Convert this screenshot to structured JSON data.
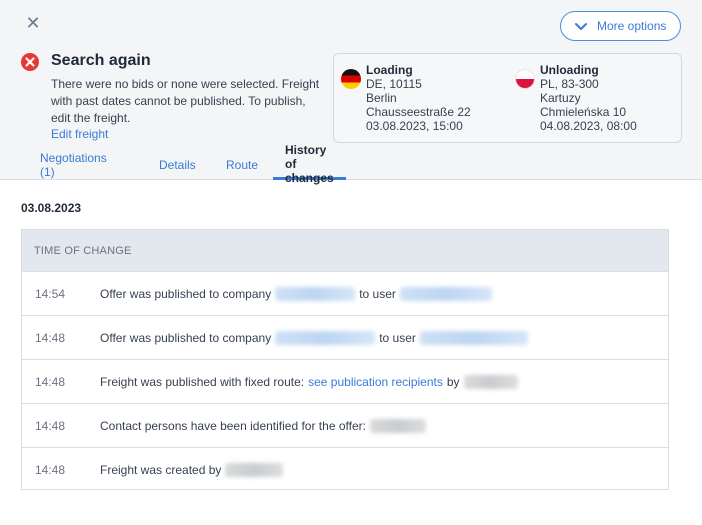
{
  "header": {
    "more_options_label": "More options",
    "status": {
      "title": "Search again",
      "text": "There were no bids or none were selected. Freight with past dates cannot be published. To publish, edit the freight.",
      "edit_link": "Edit freight"
    },
    "loading": {
      "label": "Loading",
      "country_zip": "DE, 10115",
      "city": "Berlin",
      "street": "Chausseestraße 22",
      "datetime": "03.08.2023, 15:00"
    },
    "unloading": {
      "label": "Unloading",
      "country_zip": "PL, 83-300",
      "city": "Kartuzy",
      "street": "Chmieleńska 10",
      "datetime": "04.08.2023, 08:00"
    },
    "tabs": [
      {
        "label": "Negotiations (1)"
      },
      {
        "label": "Details"
      },
      {
        "label": "Route"
      },
      {
        "label": "History of changes"
      }
    ]
  },
  "history": {
    "date": "03.08.2023",
    "column_header": "TIME OF CHANGE",
    "rows": [
      {
        "time": "14:54",
        "text_a": "Offer was published to company",
        "text_b": "to user"
      },
      {
        "time": "14:48",
        "text_a": "Offer was published to company",
        "text_b": "to user"
      },
      {
        "time": "14:48",
        "text_a": "Freight was published with fixed route:",
        "link": "see publication recipients",
        "text_b": "by"
      },
      {
        "time": "14:48",
        "text_a": "Contact persons have been identified for the offer:"
      },
      {
        "time": "14:48",
        "text_a": "Freight was created by"
      }
    ]
  },
  "colors": {
    "accent": "#3a7bd5",
    "error": "#e53935",
    "header_bg": "#f3f5f7",
    "table_head_bg": "#e3e8ee"
  }
}
